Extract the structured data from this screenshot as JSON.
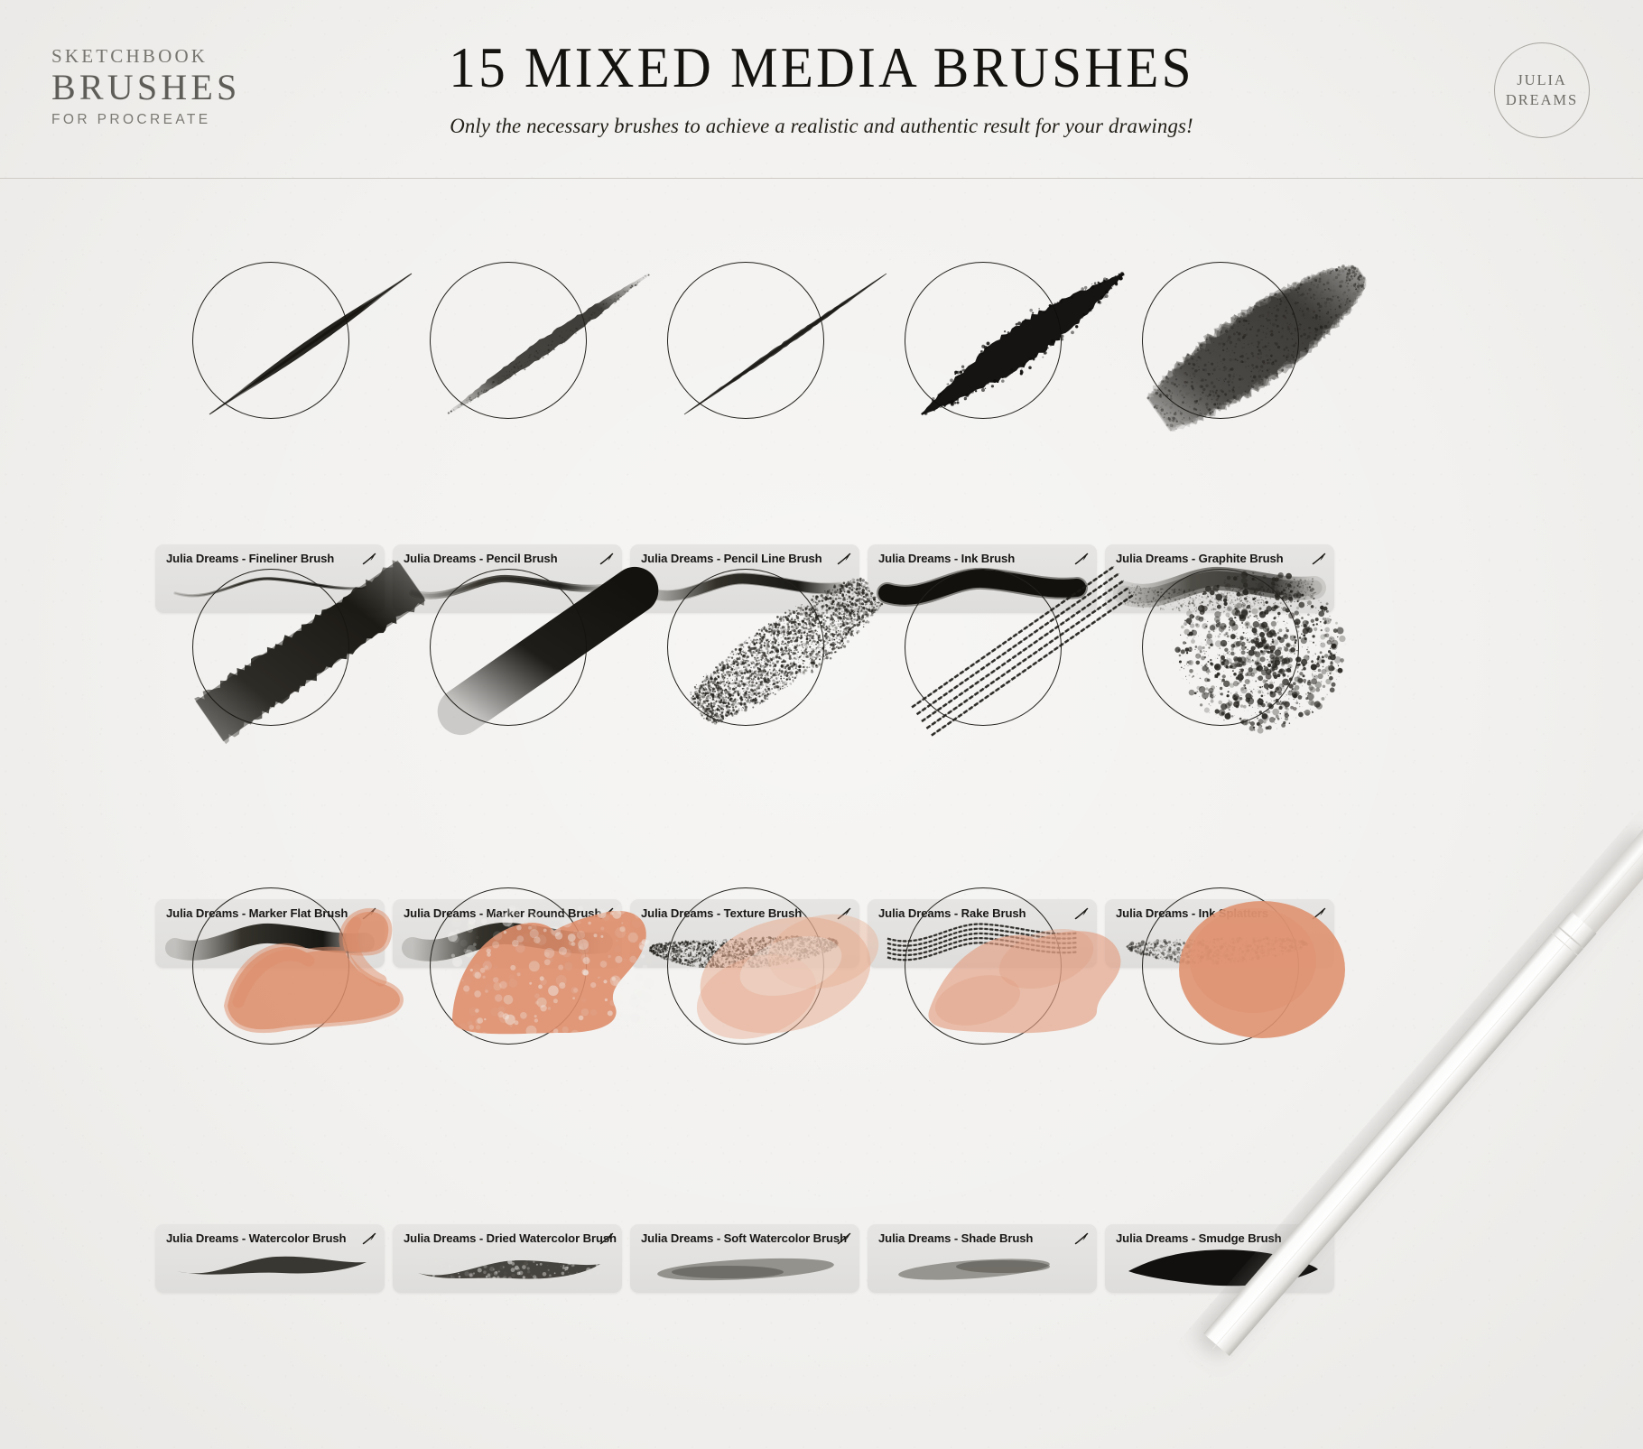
{
  "meta": {
    "background_color": "#f2f1ef",
    "ink_color": "#1a1815",
    "accent_color": "#dd8d6a"
  },
  "header": {
    "logo": {
      "line1": "SKETCHBOOK",
      "line2": "BRUSHES",
      "line3": "FOR PROCREATE"
    },
    "title": "15 MIXED MEDIA BRUSHES",
    "subtitle": "Only the necessary brushes to achieve a realistic and authentic result for your drawings!",
    "badge": {
      "line1": "JULIA",
      "line2": "DREAMS"
    }
  },
  "grid": {
    "rows": [
      {
        "name": "row-ink",
        "cells": [
          {
            "label": "Julia Dreams - Fineliner Brush",
            "brush": "fineliner",
            "ink": "#16140f"
          },
          {
            "label": "Julia Dreams - Pencil Brush",
            "brush": "pencil",
            "ink": "#24221d"
          },
          {
            "label": "Julia Dreams - Pencil Line Brush",
            "brush": "pencil-line",
            "ink": "#1b1915"
          },
          {
            "label": "Julia Dreams - Ink Brush",
            "brush": "ink",
            "ink": "#0d0c0a"
          },
          {
            "label": "Julia Dreams - Graphite Brush",
            "brush": "graphite",
            "ink": "#1a1814"
          }
        ]
      },
      {
        "name": "row-marker",
        "cells": [
          {
            "label": "Julia Dreams - Marker Flat Brush",
            "brush": "marker-flat",
            "ink": "#17150f"
          },
          {
            "label": "Julia Dreams - Marker Round Brush",
            "brush": "marker-round",
            "ink": "#14120e"
          },
          {
            "label": "Julia Dreams - Texture Brush",
            "brush": "texture",
            "ink": "#23211c"
          },
          {
            "label": "Julia Dreams - Rake Brush",
            "brush": "rake",
            "ink": "#1d1b17"
          },
          {
            "label": "Julia Dreams - Ink Splatters",
            "brush": "splatters",
            "ink": "#26241f"
          }
        ]
      },
      {
        "name": "row-watercolor",
        "cells": [
          {
            "label": "Julia Dreams - Watercolor Brush",
            "brush": "watercolor",
            "ink": "#dd8d6a"
          },
          {
            "label": "Julia Dreams - Dried Watercolor Brush",
            "brush": "dried-watercolor",
            "ink": "#de8e6b"
          },
          {
            "label": "Julia Dreams - Soft Watercolor Brush",
            "brush": "soft-watercolor",
            "ink": "#e7ad92"
          },
          {
            "label": "Julia Dreams - Shade Brush",
            "brush": "shade",
            "ink": "#e2a084"
          },
          {
            "label": "Julia Dreams - Smudge Brush",
            "brush": "smudge",
            "ink": "#df9271"
          }
        ]
      }
    ]
  },
  "icons": {
    "edit": "edit-stroke-icon"
  },
  "overlay": {
    "stylus": "apple-pencil"
  }
}
